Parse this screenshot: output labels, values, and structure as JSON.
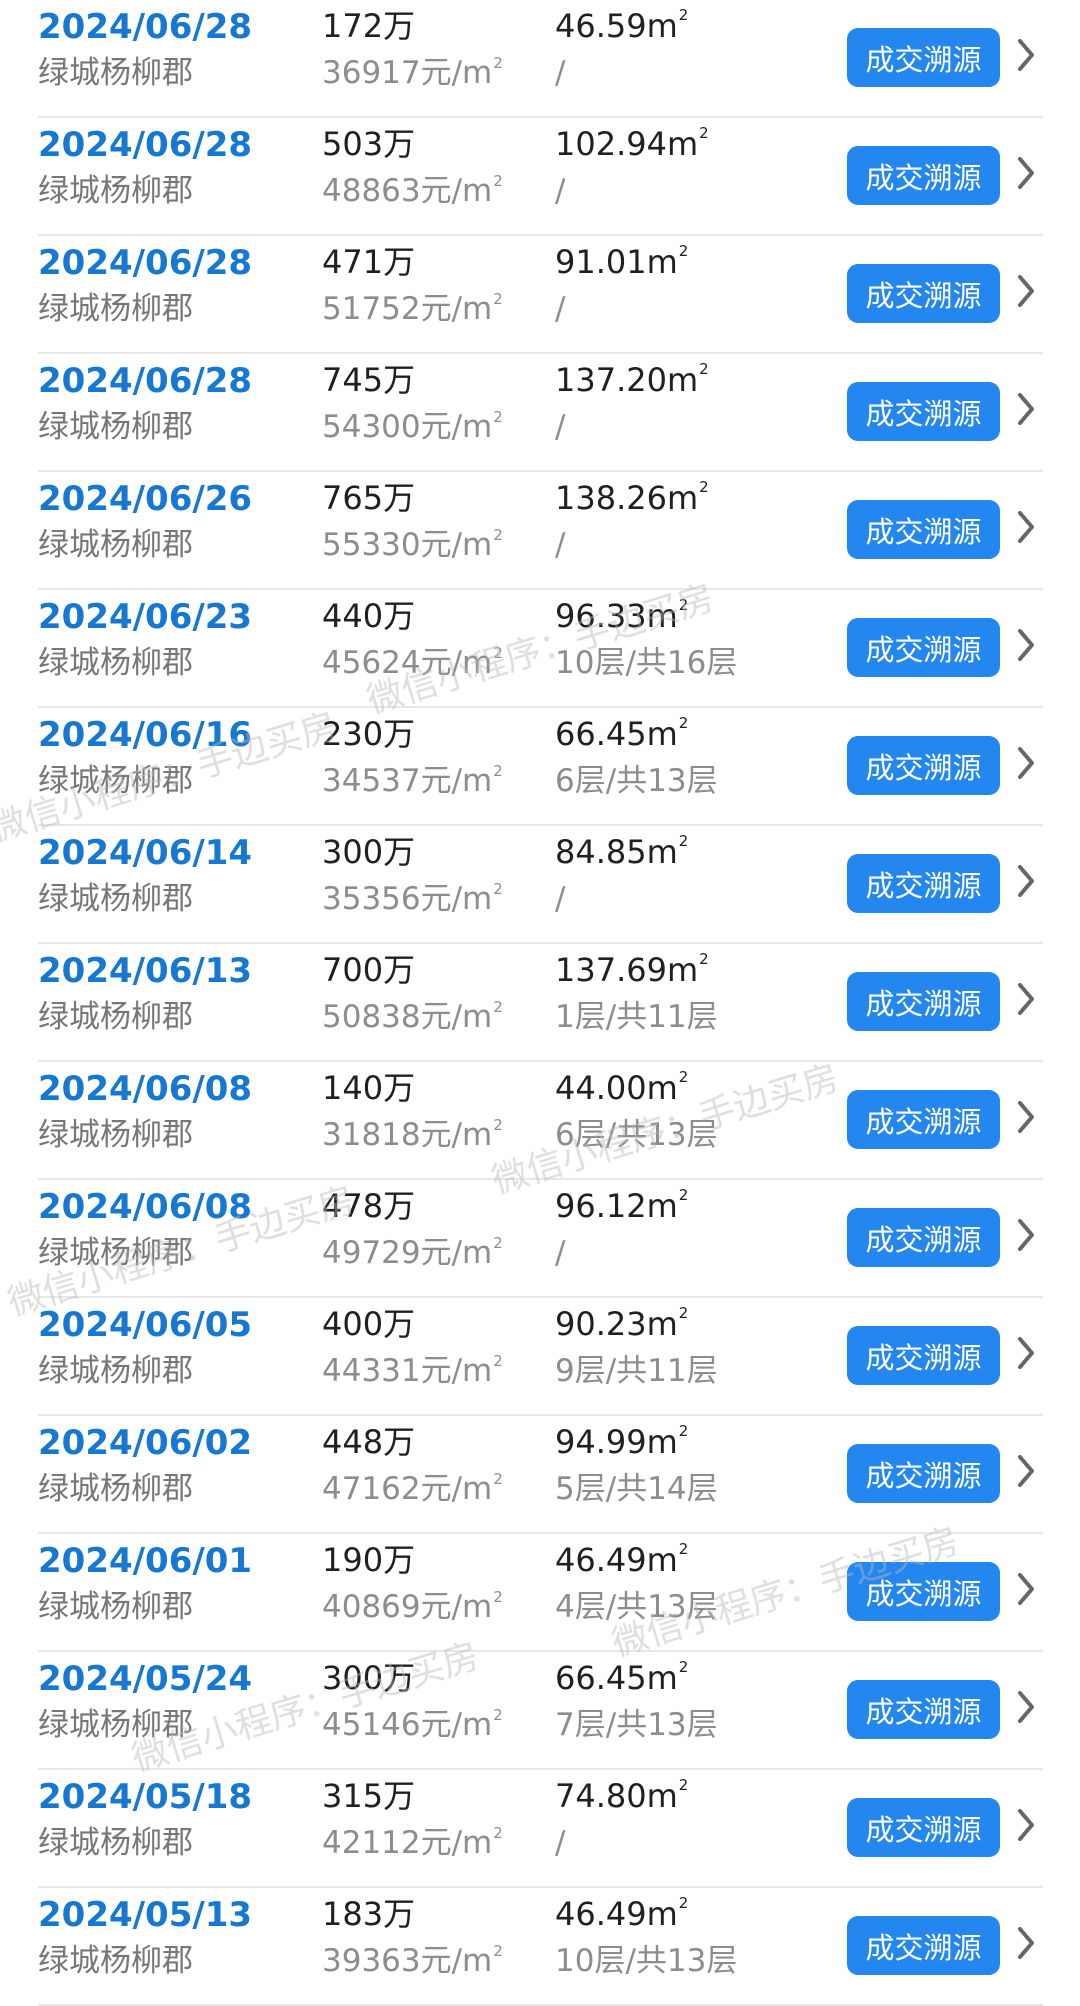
{
  "rows": [
    {
      "date": "2024/06/28",
      "community": "绿城杨柳郡",
      "price": "172万",
      "unit_price": "36917元/m",
      "unit_price_sup": "2",
      "area": "46.59m",
      "area_sup": "2",
      "floor": "/",
      "button": "成交溯源"
    },
    {
      "date": "2024/06/28",
      "community": "绿城杨柳郡",
      "price": "503万",
      "unit_price": "48863元/m",
      "unit_price_sup": "2",
      "area": "102.94m",
      "area_sup": "2",
      "floor": "/",
      "button": "成交溯源"
    },
    {
      "date": "2024/06/28",
      "community": "绿城杨柳郡",
      "price": "471万",
      "unit_price": "51752元/m",
      "unit_price_sup": "2",
      "area": "91.01m",
      "area_sup": "2",
      "floor": "/",
      "button": "成交溯源"
    },
    {
      "date": "2024/06/28",
      "community": "绿城杨柳郡",
      "price": "745万",
      "unit_price": "54300元/m",
      "unit_price_sup": "2",
      "area": "137.20m",
      "area_sup": "2",
      "floor": "/",
      "button": "成交溯源"
    },
    {
      "date": "2024/06/26",
      "community": "绿城杨柳郡",
      "price": "765万",
      "unit_price": "55330元/m",
      "unit_price_sup": "2",
      "area": "138.26m",
      "area_sup": "2",
      "floor": "/",
      "button": "成交溯源"
    },
    {
      "date": "2024/06/23",
      "community": "绿城杨柳郡",
      "price": "440万",
      "unit_price": "45624元/m",
      "unit_price_sup": "2",
      "area": "96.33m",
      "area_sup": "2",
      "floor": "10层/共16层",
      "button": "成交溯源"
    },
    {
      "date": "2024/06/16",
      "community": "绿城杨柳郡",
      "price": "230万",
      "unit_price": "34537元/m",
      "unit_price_sup": "2",
      "area": "66.45m",
      "area_sup": "2",
      "floor": "6层/共13层",
      "button": "成交溯源"
    },
    {
      "date": "2024/06/14",
      "community": "绿城杨柳郡",
      "price": "300万",
      "unit_price": "35356元/m",
      "unit_price_sup": "2",
      "area": "84.85m",
      "area_sup": "2",
      "floor": "/",
      "button": "成交溯源"
    },
    {
      "date": "2024/06/13",
      "community": "绿城杨柳郡",
      "price": "700万",
      "unit_price": "50838元/m",
      "unit_price_sup": "2",
      "area": "137.69m",
      "area_sup": "2",
      "floor": "1层/共11层",
      "button": "成交溯源"
    },
    {
      "date": "2024/06/08",
      "community": "绿城杨柳郡",
      "price": "140万",
      "unit_price": "31818元/m",
      "unit_price_sup": "2",
      "area": "44.00m",
      "area_sup": "2",
      "floor": "6层/共13层",
      "button": "成交溯源"
    },
    {
      "date": "2024/06/08",
      "community": "绿城杨柳郡",
      "price": "478万",
      "unit_price": "49729元/m",
      "unit_price_sup": "2",
      "area": "96.12m",
      "area_sup": "2",
      "floor": "/",
      "button": "成交溯源"
    },
    {
      "date": "2024/06/05",
      "community": "绿城杨柳郡",
      "price": "400万",
      "unit_price": "44331元/m",
      "unit_price_sup": "2",
      "area": "90.23m",
      "area_sup": "2",
      "floor": "9层/共11层",
      "button": "成交溯源"
    },
    {
      "date": "2024/06/02",
      "community": "绿城杨柳郡",
      "price": "448万",
      "unit_price": "47162元/m",
      "unit_price_sup": "2",
      "area": "94.99m",
      "area_sup": "2",
      "floor": "5层/共14层",
      "button": "成交溯源"
    },
    {
      "date": "2024/06/01",
      "community": "绿城杨柳郡",
      "price": "190万",
      "unit_price": "40869元/m",
      "unit_price_sup": "2",
      "area": "46.49m",
      "area_sup": "2",
      "floor": "4层/共13层",
      "button": "成交溯源"
    },
    {
      "date": "2024/05/24",
      "community": "绿城杨柳郡",
      "price": "300万",
      "unit_price": "45146元/m",
      "unit_price_sup": "2",
      "area": "66.45m",
      "area_sup": "2",
      "floor": "7层/共13层",
      "button": "成交溯源"
    },
    {
      "date": "2024/05/18",
      "community": "绿城杨柳郡",
      "price": "315万",
      "unit_price": "42112元/m",
      "unit_price_sup": "2",
      "area": "74.80m",
      "area_sup": "2",
      "floor": "/",
      "button": "成交溯源"
    },
    {
      "date": "2024/05/13",
      "community": "绿城杨柳郡",
      "price": "183万",
      "unit_price": "39363元/m",
      "unit_price_sup": "2",
      "area": "46.49m",
      "area_sup": "2",
      "floor": "10层/共13层",
      "button": "成交溯源"
    }
  ],
  "watermarks": [
    {
      "text": "微信小程序：手边买房"
    },
    {
      "text": "微信小程序：手边买房"
    },
    {
      "text": "微信小程序：手边买房"
    },
    {
      "text": "微信小程序：手边买房"
    },
    {
      "text": "微信小程序：手边买房"
    },
    {
      "text": "微信小程序：手边买房"
    }
  ],
  "icons": {
    "chevron": "chevron-right-icon"
  },
  "colors": {
    "date_blue": "#1778d1",
    "button_blue": "#2487ef",
    "divider": "#e7e7e7",
    "watermark": "#b9b9b9"
  }
}
